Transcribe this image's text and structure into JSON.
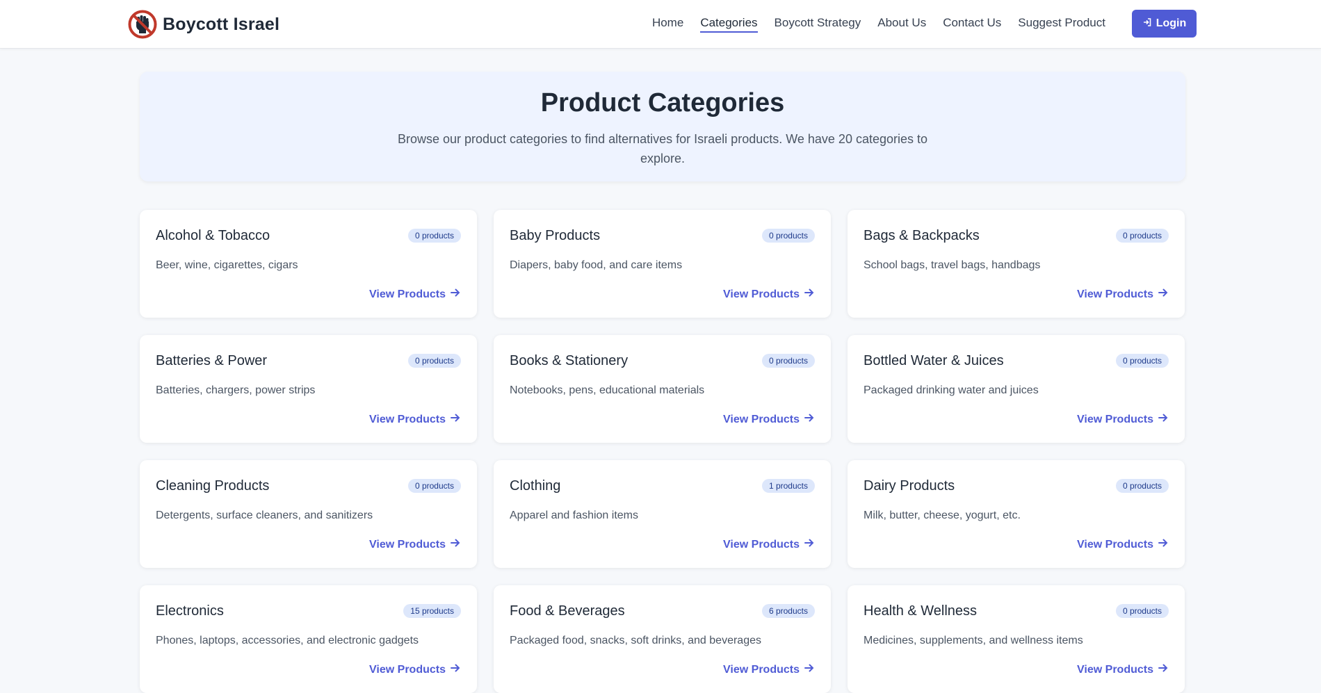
{
  "header": {
    "brand": "Boycott Israel",
    "nav": [
      "Home",
      "Categories",
      "Boycott Strategy",
      "About Us",
      "Contact Us",
      "Suggest Product"
    ],
    "active_nav": "Categories",
    "login_label": "Login"
  },
  "hero": {
    "title": "Product Categories",
    "subtitle": "Browse our product categories to find alternatives for Israeli products. We have 20 categories to explore."
  },
  "colors": {
    "accent": "#4f5bd5",
    "badge_bg": "#dde7fb",
    "logo_red": "#c0392b"
  },
  "cards": [
    {
      "title": "Alcohol & Tobacco",
      "badge": "0 products",
      "desc": "Beer, wine, cigarettes, cigars",
      "link": "View Products"
    },
    {
      "title": "Baby Products",
      "badge": "0 products",
      "desc": "Diapers, baby food, and care items",
      "link": "View Products"
    },
    {
      "title": "Bags & Backpacks",
      "badge": "0 products",
      "desc": "School bags, travel bags, handbags",
      "link": "View Products"
    },
    {
      "title": "Batteries & Power",
      "badge": "0 products",
      "desc": "Batteries, chargers, power strips",
      "link": "View Products"
    },
    {
      "title": "Books & Stationery",
      "badge": "0 products",
      "desc": "Notebooks, pens, educational materials",
      "link": "View Products"
    },
    {
      "title": "Bottled Water & Juices",
      "badge": "0 products",
      "desc": "Packaged drinking water and juices",
      "link": "View Products"
    },
    {
      "title": "Cleaning Products",
      "badge": "0 products",
      "desc": "Detergents, surface cleaners, and sanitizers",
      "link": "View Products"
    },
    {
      "title": "Clothing",
      "badge": "1 products",
      "desc": "Apparel and fashion items",
      "link": "View Products"
    },
    {
      "title": "Dairy Products",
      "badge": "0 products",
      "desc": "Milk, butter, cheese, yogurt, etc.",
      "link": "View Products"
    },
    {
      "title": "Electronics",
      "badge": "15 products",
      "desc": "Phones, laptops, accessories, and electronic gadgets",
      "link": "View Products"
    },
    {
      "title": "Food & Beverages",
      "badge": "6 products",
      "desc": "Packaged food, snacks, soft drinks, and beverages",
      "link": "View Products"
    },
    {
      "title": "Health & Wellness",
      "badge": "0 products",
      "desc": "Medicines, supplements, and wellness items",
      "link": "View Products"
    }
  ]
}
